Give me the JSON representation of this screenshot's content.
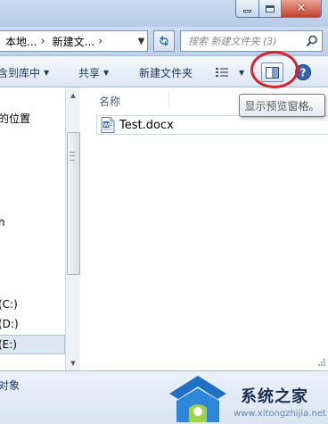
{
  "address_bar": {
    "crumbs": [
      "本地...",
      "新建文..."
    ],
    "search_placeholder": "搜索 新建文件夹 (3)"
  },
  "toolbar": {
    "include_in_library": "含到库中",
    "share": "共享",
    "new_folder": "新建文件夹"
  },
  "tooltip": "显示预览窗格。",
  "nav_pane": {
    "items": [
      "的位置",
      "n",
      "(C:)",
      "(D:)",
      "(E:)"
    ]
  },
  "file_list": {
    "column_name": "名称",
    "files": [
      {
        "name": "Test.docx",
        "icon": "word-document-icon"
      }
    ]
  },
  "details_bar": {
    "text": "对象"
  },
  "watermark": {
    "brand": "系统之家",
    "url": "www.xitongzhijia.net"
  },
  "colors": {
    "annotation_circle": "#d2262c",
    "window_frame": "#c9dbee"
  }
}
